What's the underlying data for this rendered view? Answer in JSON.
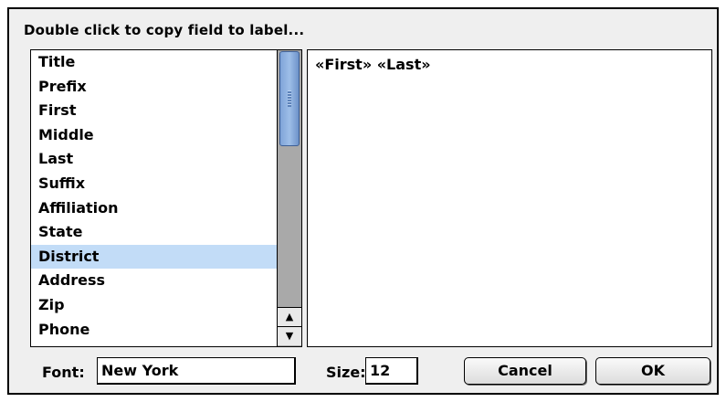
{
  "header": {
    "instruction": "Double click to copy field to label..."
  },
  "field_list": {
    "items": [
      "Title",
      "Prefix",
      "First",
      "Middle",
      "Last",
      "Suffix",
      "Affiliation",
      "State",
      "District",
      "Address",
      "Zip",
      "Phone"
    ],
    "selected": "District"
  },
  "label_text": "«First» «Last»",
  "font": {
    "label": "Font:",
    "value": "New York"
  },
  "size": {
    "label": "Size:",
    "value": "12"
  },
  "buttons": {
    "cancel": "Cancel",
    "ok": "OK"
  },
  "colors": {
    "selection": "#c2dcf7",
    "scroll_thumb": "#8eb0e0"
  }
}
